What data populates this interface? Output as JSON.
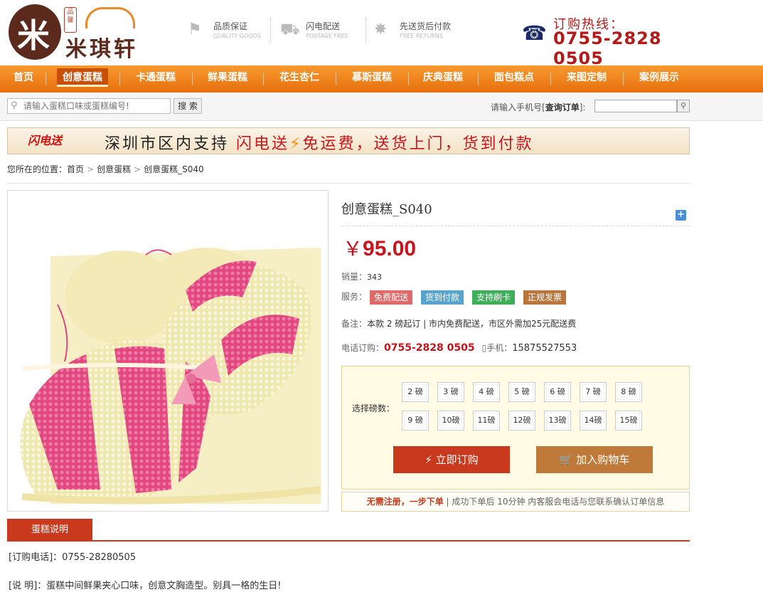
{
  "brand": {
    "seal": "品馨",
    "name": "米琪轩"
  },
  "features": [
    {
      "title": "品质保证",
      "sub": "QUALITY GOODS",
      "icon": "bookmark-icon"
    },
    {
      "title": "闪电配送",
      "sub": "POSTAGE FREE",
      "icon": "truck-icon"
    },
    {
      "title": "先送货后付款",
      "sub": "FREE RETURNS",
      "icon": "handshake-icon"
    }
  ],
  "hotline": {
    "label": "订购热线：",
    "number": "0755-2828 0505"
  },
  "nav": [
    "首页",
    "创意蛋糕",
    "卡通蛋糕",
    "鲜果蛋糕",
    "花生杏仁",
    "慕斯蛋糕",
    "庆典蛋糕",
    "面包糕点",
    "来图定制",
    "案例展示"
  ],
  "search": {
    "placeholder": "请输入蛋糕口味或蛋糕编号!",
    "button": "搜 索",
    "order_label_pre": "请输入手机号[",
    "order_label_bold": "查询订单",
    "order_label_post": "]:"
  },
  "banner": {
    "flash_logo": "闪电送",
    "text_1": "深圳市区内支持 ",
    "text_red": "闪电送",
    "text_2": "免运费，送货上门，货到付款"
  },
  "breadcrumb": {
    "prefix": "您所在的位置：",
    "items": [
      "首页",
      "创意蛋糕",
      "创意蛋糕_S040"
    ]
  },
  "product": {
    "title": "创意蛋糕_S040",
    "currency": "￥",
    "price": "95.00",
    "sales_label": "销量：",
    "sales": "343",
    "service_label": "服务：",
    "services": [
      {
        "label": "免费配送",
        "color": "#e06a6a"
      },
      {
        "label": "货到付款",
        "color": "#5aa3cf"
      },
      {
        "label": "支持刷卡",
        "color": "#3fae5a"
      },
      {
        "label": "正规发票",
        "color": "#b8763c"
      }
    ],
    "note_label": "备注：",
    "note": "本款 2 磅起订 | 市内免费配送，市区外需加25元配送费",
    "phone_label": "电话订购：",
    "phone": "0755-2828 0505",
    "mobile_label": "手机：",
    "mobile": "15875527553"
  },
  "weights": {
    "label": "选择磅数：",
    "options": [
      "2 磅",
      "3 磅",
      "4 磅",
      "5 磅",
      "6 磅",
      "7 磅",
      "8 磅",
      "9 磅",
      "10磅",
      "11磅",
      "12磅",
      "13磅",
      "14磅",
      "15磅"
    ]
  },
  "actions": {
    "buy": "立即订购",
    "cart": "加入购物车"
  },
  "notice": {
    "highlight": "无需注册，一步下单",
    "text": "成功下单后 10分钟 内客服会电话与您联系确认订单信息"
  },
  "description": {
    "tab": "蛋糕说明",
    "line1": "[订购电话]：0755-28280505",
    "line2": "[说 明]：蛋糕中间鲜果夹心口味，创意文胸造型。别具一格的生日!"
  },
  "colors": {
    "nav": "#f07f1a",
    "accent": "#c8391d",
    "price": "#c8141c"
  }
}
